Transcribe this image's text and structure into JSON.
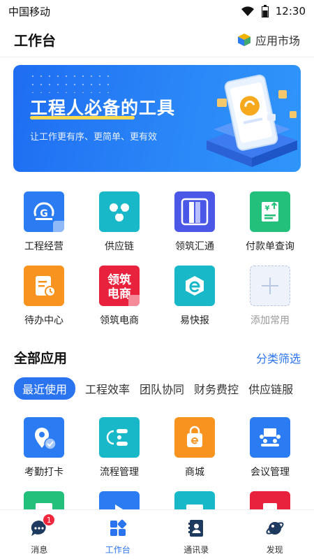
{
  "status_bar": {
    "carrier": "中国移动",
    "time": "12:30"
  },
  "header": {
    "title": "工作台",
    "market_label": "应用市场"
  },
  "banner": {
    "headline": "工程人必备的工具",
    "subtitle": "让工作更有序、更简单、更有效"
  },
  "common_apps": [
    {
      "label": "工程经营",
      "icon": "engineering-icon",
      "color": "#2b7cf2"
    },
    {
      "label": "供应链",
      "icon": "supply-chain-icon",
      "color": "#19b8c9"
    },
    {
      "label": "领筑汇通",
      "icon": "lingzhu-huitong-icon",
      "color": "#4b57e6"
    },
    {
      "label": "付款单查询",
      "icon": "payment-query-icon",
      "color": "#22c07a"
    },
    {
      "label": "待办中心",
      "icon": "todo-center-icon",
      "color": "#f7931e"
    },
    {
      "label": "领筑电商",
      "icon": "ecommerce-icon",
      "color": "#e8223c",
      "icon_text": "领筑电商"
    },
    {
      "label": "易快报",
      "icon": "yikuaibao-icon",
      "color": "#19b8c9"
    },
    {
      "label": "添加常用",
      "icon": "add-icon",
      "color": "#eef2fa"
    }
  ],
  "all_apps": {
    "title": "全部应用",
    "filter_label": "分类筛选",
    "categories": [
      "最近使用",
      "工程效率",
      "团队协同",
      "财务费控",
      "供应链服"
    ],
    "apps": [
      {
        "label": "考勤打卡",
        "icon": "location-check-icon",
        "color": "#2b7cf2"
      },
      {
        "label": "流程管理",
        "icon": "workflow-icon",
        "color": "#19b8c9"
      },
      {
        "label": "商城",
        "icon": "shopping-bag-icon",
        "color": "#f7931e"
      },
      {
        "label": "会议管理",
        "icon": "meeting-icon",
        "color": "#2b7cf2"
      }
    ]
  },
  "tabbar": [
    {
      "label": "消息",
      "icon": "message-icon",
      "badge": "1"
    },
    {
      "label": "工作台",
      "icon": "workbench-icon"
    },
    {
      "label": "通讯录",
      "icon": "contacts-icon"
    },
    {
      "label": "发现",
      "icon": "discover-icon"
    }
  ],
  "colors": {
    "accent": "#2b74f0",
    "banner_start": "#1f6df2",
    "banner_end": "#2f95fa"
  }
}
